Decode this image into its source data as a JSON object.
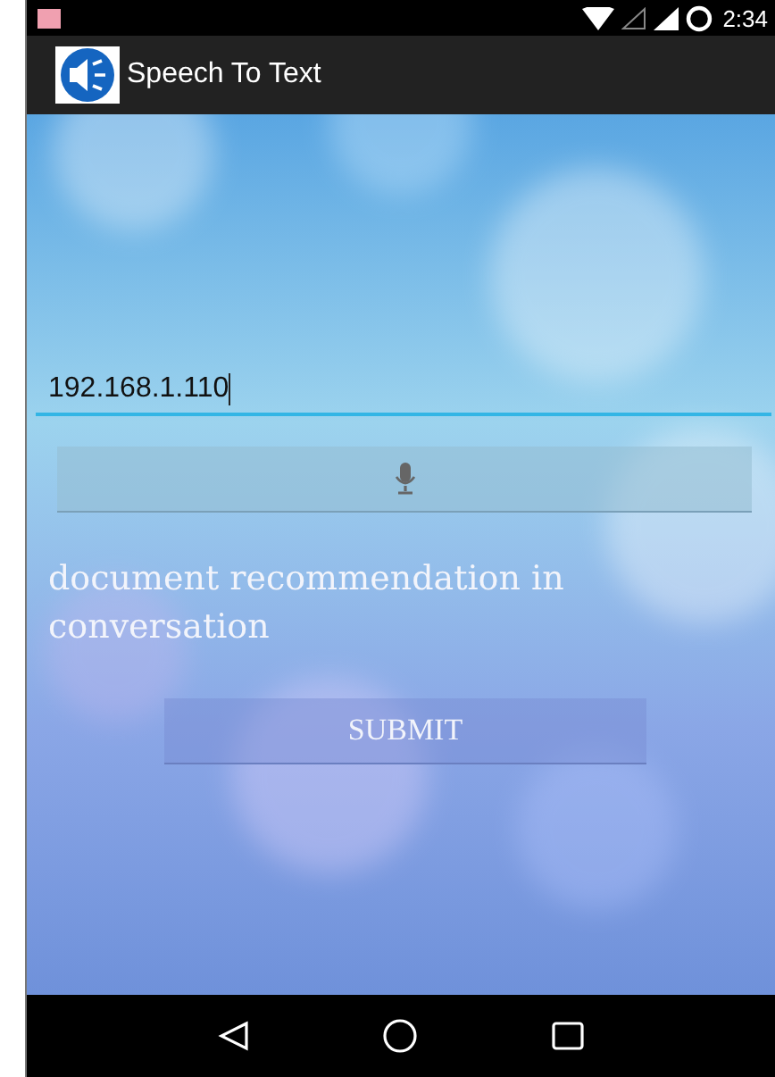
{
  "status_bar": {
    "time": "2:34"
  },
  "app_bar": {
    "title": "Speech To Text"
  },
  "server_field": {
    "value": "192.168.1.110"
  },
  "recognized_text": "document recommendation in conversation",
  "submit_button": {
    "label": "SUBMIT"
  }
}
